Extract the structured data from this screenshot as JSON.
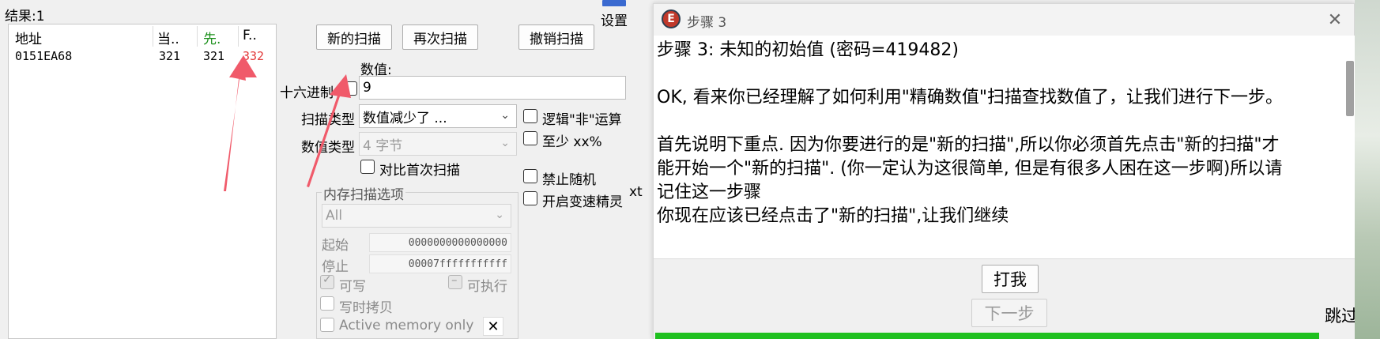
{
  "ce": {
    "results_label": "结果:1",
    "settings_label": "设置",
    "columns": [
      "地址",
      "当..",
      "先.",
      "F.."
    ],
    "rows": [
      {
        "address": "0151EA68",
        "current": "321",
        "previous": "321",
        "first": "332"
      }
    ],
    "buttons": {
      "new_scan": "新的扫描",
      "next_scan": "再次扫描",
      "undo_scan": "撤销扫描"
    },
    "value_label": "数值:",
    "hex_label": "十六进制",
    "value_input": "9",
    "scan_type_label": "扫描类型",
    "scan_type_value": "数值减少了 ...",
    "value_type_label": "数值类型",
    "value_type_value": "4 字节",
    "compare_first": "对比首次扫描",
    "logic_not": "逻辑\"非\"运算",
    "at_least": "至少 xx%",
    "no_random": "禁止随机",
    "speedhack": "开启变速精灵",
    "memory_options": {
      "title": "内存扫描选项",
      "region": "All",
      "start_label": "起始",
      "start_value": "0000000000000000",
      "stop_label": "停止",
      "stop_value": "00007fffffffffff",
      "writable": "可写",
      "executable": "可执行",
      "copy_on_write": "写时拷贝",
      "active_memory": "Active memory only"
    },
    "edge_text": "xt",
    "colors": {
      "highlight_red": "#e23a3a",
      "green": "#1a8f1a",
      "arrow": "#f05a6a"
    }
  },
  "dialog": {
    "title": "步骤 3",
    "heading": "步骤 3: 未知的初始值 (密码=419482)",
    "para1": "OK, 看来你已经理解了如何利用\"精确数值\"扫描查找数值了，让我们进行下一步。",
    "para2_line1": "首先说明下重点. 因为你要进行的是\"新的扫描\",所以你必须首先点击\"新的扫描\"才",
    "para2_line2": "能开始一个\"新的扫描\". (你一定认为这很简单, 但是有很多人困在这一步啊)所以请",
    "para2_line3": "记住这一步骤",
    "para3": "你现在应该已经点击了\"新的扫描\",让我们继续",
    "hit_me": "打我",
    "next": "下一步",
    "skip": "跳过",
    "progress": 1.0,
    "colors": {
      "progress": "#1fc01f"
    }
  }
}
